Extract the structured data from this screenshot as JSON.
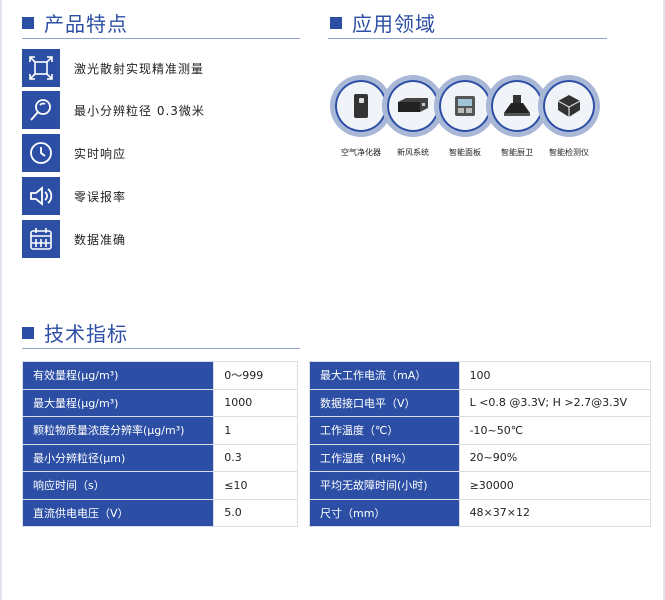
{
  "features": {
    "title": "产品特点",
    "items": [
      {
        "label": "激光散射实现精准测量",
        "icon": "fullscreen-icon"
      },
      {
        "label": "最小分辨粒径 0.3微米",
        "icon": "magnifier-icon"
      },
      {
        "label": "实时响应",
        "icon": "clock-icon"
      },
      {
        "label": "零误报率",
        "icon": "speaker-icon"
      },
      {
        "label": "数据准确",
        "icon": "calendar-icon"
      }
    ]
  },
  "applications": {
    "title": "应用领域",
    "items": [
      {
        "label": "空气净化器",
        "icon": "air-purifier-icon"
      },
      {
        "label": "新风系统",
        "icon": "fresh-air-unit-icon"
      },
      {
        "label": "智能面板",
        "icon": "smart-panel-icon"
      },
      {
        "label": "智能厨卫",
        "icon": "range-hood-icon"
      },
      {
        "label": "智能检测仪",
        "icon": "detector-icon"
      }
    ]
  },
  "specs": {
    "title": "技术指标",
    "left": [
      {
        "k": "有效量程(μg/m³)",
        "v": "0～999"
      },
      {
        "k": "最大量程(μg/m³)",
        "v": "1000"
      },
      {
        "k": "颗粒物质量浓度分辨率(μg/m³)",
        "v": "1"
      },
      {
        "k": "最小分辨粒径(μm)",
        "v": "0.3"
      },
      {
        "k": "响应时间（s）",
        "v": "≤10"
      },
      {
        "k": "直流供电电压（V）",
        "v": "5.0"
      }
    ],
    "right": [
      {
        "k": "最大工作电流（mA）",
        "v": "100"
      },
      {
        "k": "数据接口电平（V）",
        "v": "L <0.8 @3.3V; H >2.7@3.3V"
      },
      {
        "k": "工作温度（℃）",
        "v": "-10~50℃"
      },
      {
        "k": "工作湿度（RH%）",
        "v": "20~90%"
      },
      {
        "k": "平均无故障时间(小时)",
        "v": "≥30000"
      },
      {
        "k": "尺寸（mm）",
        "v": "48×37×12"
      }
    ]
  },
  "colors": {
    "accent": "#2c4fa5",
    "ring": "#aab8d8"
  }
}
